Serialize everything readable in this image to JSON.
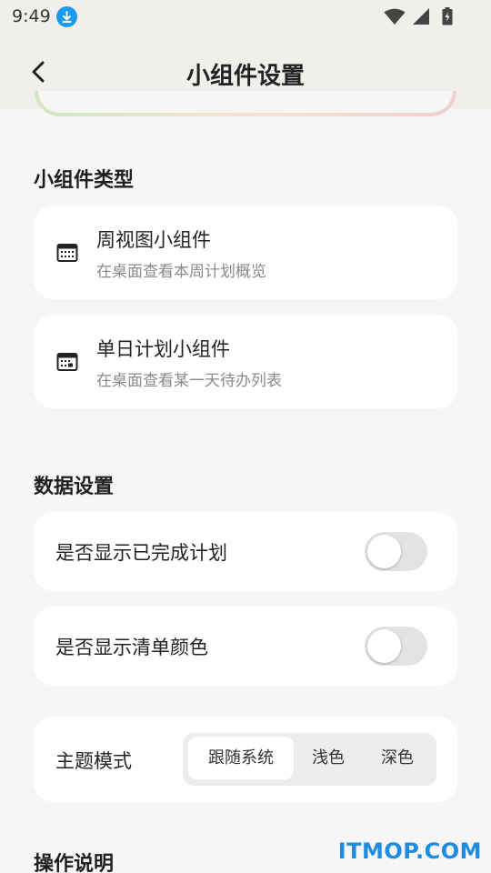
{
  "status_bar": {
    "time": "9:49",
    "icons": [
      "download-icon",
      "wifi-icon",
      "signal-icon",
      "battery-charging-icon"
    ],
    "download_color": "#1a9bf0"
  },
  "app_bar": {
    "title": "小组件设置",
    "back_icon": "chevron-left-icon"
  },
  "sections": {
    "widget_types": {
      "title": "小组件类型",
      "items": [
        {
          "icon": "calendar-week-icon",
          "title": "周视图小组件",
          "subtitle": "在桌面查看本周计划概览"
        },
        {
          "icon": "calendar-day-icon",
          "title": "单日计划小组件",
          "subtitle": "在桌面查看某一天待办列表"
        }
      ]
    },
    "data_settings": {
      "title": "数据设置",
      "toggles": [
        {
          "label": "是否显示已完成计划",
          "on": false
        },
        {
          "label": "是否显示清单颜色",
          "on": false
        }
      ],
      "theme": {
        "label": "主题模式",
        "options": [
          "跟随系统",
          "浅色",
          "深色"
        ],
        "selected": "跟随系统"
      }
    },
    "instructions": {
      "title": "操作说明"
    }
  },
  "watermark": "ITMOP.COM",
  "colors": {
    "background": "#f6f6f6",
    "app_bar": "#f1efeb",
    "card": "#ffffff",
    "toggle_off": "#e3e3e3",
    "watermark": "#1e8de0"
  }
}
